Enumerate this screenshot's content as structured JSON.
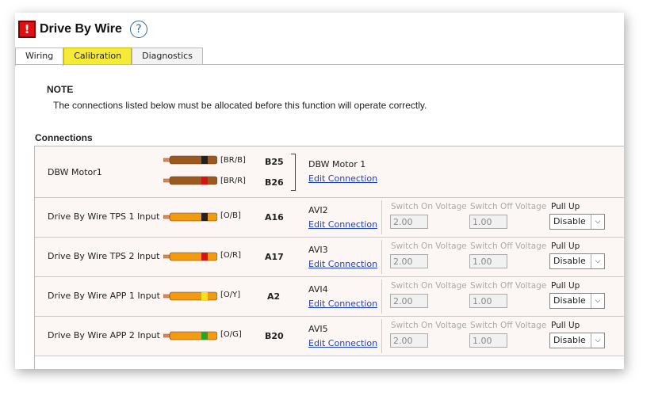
{
  "header": {
    "title": "Drive By Wire",
    "alert_glyph": "!",
    "help_glyph": "?"
  },
  "tabs": [
    {
      "label": "Wiring"
    },
    {
      "label": "Calibration"
    },
    {
      "label": "Diagnostics"
    }
  ],
  "note": {
    "title": "NOTE",
    "text": "The connections listed below must be allocated before this function will operate correctly."
  },
  "connections": {
    "title": "Connections",
    "motor": {
      "label": "DBW Motor1",
      "wires": [
        {
          "code": "[BR/B]",
          "pin": "B25",
          "base": "#9a5a1f",
          "stripe": "#222222"
        },
        {
          "code": "[BR/R]",
          "pin": "B26",
          "base": "#9a5a1f",
          "stripe": "#d41414"
        }
      ],
      "function_name": "DBW Motor 1",
      "edit_label": "Edit Connection"
    },
    "field_labels": {
      "switch_on": "Switch On Voltage",
      "switch_off": "Switch Off Voltage",
      "pull_up": "Pull Up"
    },
    "inputs": [
      {
        "label": "Drive By Wire TPS 1 Input",
        "code": "[O/B]",
        "pin": "A16",
        "base": "#f29a10",
        "stripe": "#222222",
        "function_name": "AVI2",
        "edit_label": "Edit Connection",
        "switch_on": "2.00",
        "switch_off": "1.00",
        "pull_up": "Disable"
      },
      {
        "label": "Drive By Wire TPS 2 Input",
        "code": "[O/R]",
        "pin": "A17",
        "base": "#f29a10",
        "stripe": "#d41414",
        "function_name": "AVI3",
        "edit_label": "Edit Connection",
        "switch_on": "2.00",
        "switch_off": "1.00",
        "pull_up": "Disable"
      },
      {
        "label": "Drive By Wire APP 1 Input",
        "code": "[O/Y]",
        "pin": "A2",
        "base": "#f29a10",
        "stripe": "#f3e21a",
        "function_name": "AVI4",
        "edit_label": "Edit Connection",
        "switch_on": "2.00",
        "switch_off": "1.00",
        "pull_up": "Disable"
      },
      {
        "label": "Drive By Wire APP 2 Input",
        "code": "[O/G]",
        "pin": "B20",
        "base": "#f29a10",
        "stripe": "#2aa42a",
        "function_name": "AVI5",
        "edit_label": "Edit Connection",
        "switch_on": "2.00",
        "switch_off": "1.00",
        "pull_up": "Disable"
      }
    ]
  }
}
